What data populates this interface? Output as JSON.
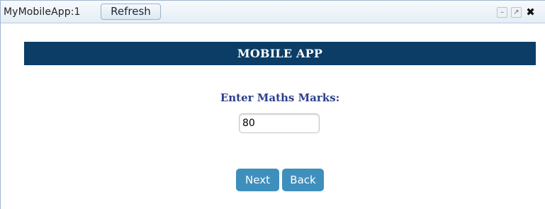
{
  "window": {
    "title": "MyMobileApp:1",
    "refresh_label": "Refresh",
    "controls": {
      "minimize_icon": "minimize-icon",
      "popout_icon": "popout-icon",
      "close_icon": "close-icon",
      "minimize_glyph": "–",
      "popout_glyph": "↗",
      "close_glyph": "✖"
    }
  },
  "app": {
    "header": "MOBILE APP",
    "field_label": "Enter Maths Marks:",
    "marks_value": "80",
    "next_label": "Next",
    "back_label": "Back"
  },
  "colors": {
    "header_bg": "#0b3d66",
    "label_text": "#2b3f8c",
    "button_bg": "#3f8fbd"
  }
}
